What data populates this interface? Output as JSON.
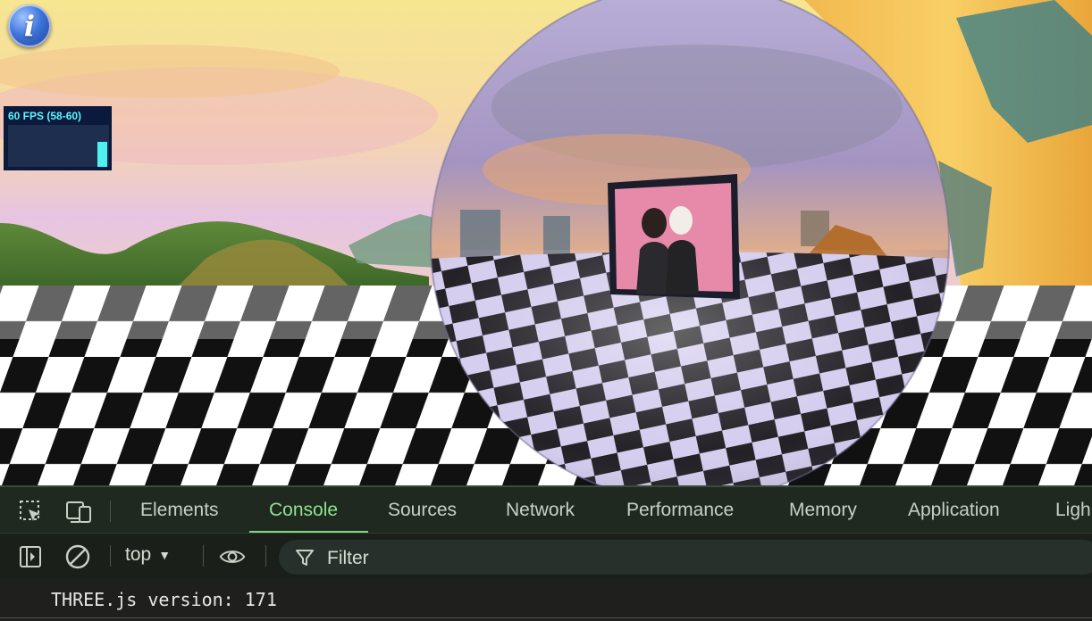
{
  "viewport": {
    "info_badge": "i",
    "stats": {
      "fps_text": "60 FPS (58-60)",
      "fps_bar_fraction": 0.6
    },
    "colors": {
      "stats_text": "#5ff4ff",
      "stats_bg": "#0b1a3c",
      "stats_bar": "#4ff0f0"
    }
  },
  "devtools": {
    "tabs": [
      {
        "label": "Elements",
        "active": false
      },
      {
        "label": "Console",
        "active": true
      },
      {
        "label": "Sources",
        "active": false
      },
      {
        "label": "Network",
        "active": false
      },
      {
        "label": "Performance",
        "active": false
      },
      {
        "label": "Memory",
        "active": false
      },
      {
        "label": "Application",
        "active": false
      },
      {
        "label": "Ligh",
        "active": false
      }
    ],
    "toolbar": {
      "context": "top",
      "filter_placeholder": "Filter"
    },
    "console": {
      "messages": [
        "THREE.js version: 171"
      ]
    },
    "icons": [
      "inspect-element-icon",
      "device-toolbar-icon",
      "sidebar-toggle-icon",
      "clear-console-icon",
      "eye-icon",
      "filter-icon"
    ],
    "colors": {
      "active_tab": "#8fe28f",
      "tab_text": "#c8d0c4"
    }
  }
}
